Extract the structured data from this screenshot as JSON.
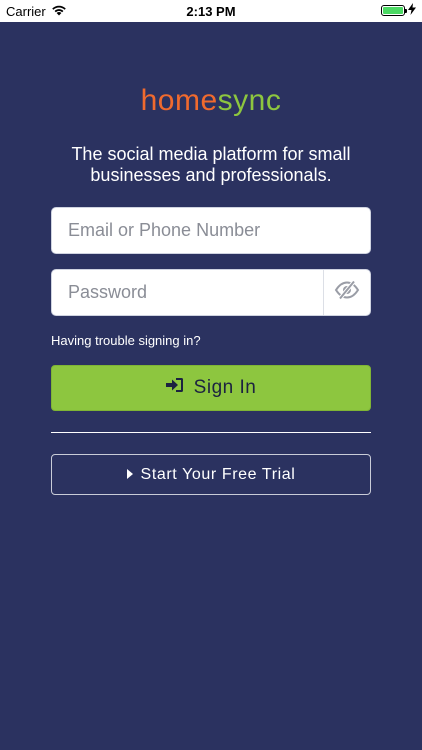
{
  "status_bar": {
    "carrier": "Carrier",
    "time": "2:13 PM",
    "battery_level": 1.0,
    "battery_color": "#4cd964"
  },
  "logo": {
    "part1": "home",
    "part2": "sync",
    "color1": "#f06a2e",
    "color2": "#8dc63f"
  },
  "tagline": "The social media platform for small businesses and professionals.",
  "login": {
    "email_placeholder": "Email or Phone Number",
    "email_value": "",
    "password_placeholder": "Password",
    "password_value": "",
    "password_toggle_icon": "eye-slash-icon",
    "trouble_link": "Having trouble signing in?",
    "sign_in_label": "Sign In",
    "sign_in_icon": "sign-in-icon",
    "trial_label": "Start Your Free Trial",
    "trial_icon": "caret-right-icon"
  },
  "colors": {
    "background": "#2b3260",
    "primary_button": "#8dc63f"
  }
}
